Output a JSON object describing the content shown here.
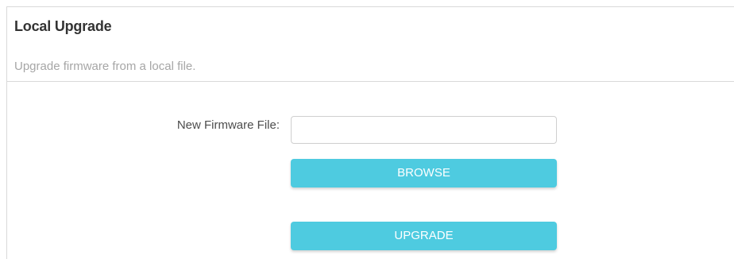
{
  "section": {
    "title": "Local Upgrade",
    "description": "Upgrade firmware from a local file."
  },
  "form": {
    "file_label": "New Firmware File:",
    "file_value": "",
    "browse_label": "BROWSE",
    "upgrade_label": "UPGRADE"
  },
  "colors": {
    "button_background": "#4ecbe0",
    "button_text": "#ffffff",
    "title_text": "#333333",
    "description_text": "#a6a6a6"
  }
}
